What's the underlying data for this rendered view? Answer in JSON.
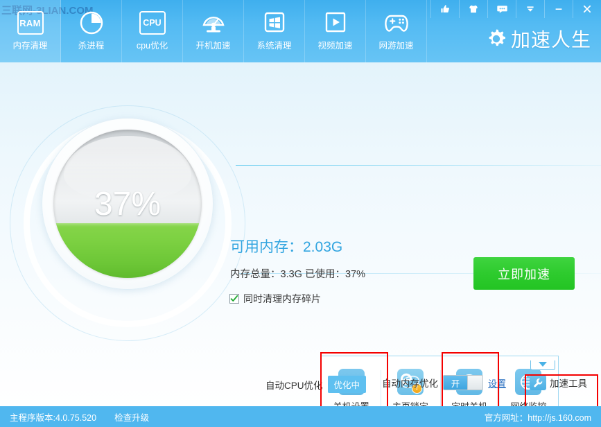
{
  "window": {
    "watermark": "三联网-3LIAN.COM",
    "brand_title": "加速人生",
    "controls": [
      {
        "name": "thumbs-up-icon",
        "label": "赞"
      },
      {
        "name": "skin-icon",
        "label": "换肤"
      },
      {
        "name": "feedback-icon",
        "label": "反馈"
      },
      {
        "name": "menu-icon",
        "label": "菜单"
      },
      {
        "name": "minimize-icon",
        "label": "最小化"
      },
      {
        "name": "close-icon",
        "label": "关闭"
      }
    ]
  },
  "nav": {
    "items": [
      {
        "label": "内存清理",
        "icon": "ram-icon",
        "active": true
      },
      {
        "label": "杀进程",
        "icon": "pie-chart-icon",
        "active": false
      },
      {
        "label": "cpu优化",
        "icon": "cpu-icon",
        "active": false
      },
      {
        "label": "开机加速",
        "icon": "speedometer-monitor-icon",
        "active": false
      },
      {
        "label": "系统清理",
        "icon": "windows-icon",
        "active": false
      },
      {
        "label": "视频加速",
        "icon": "play-video-icon",
        "active": false
      },
      {
        "label": "网游加速",
        "icon": "gamepad-icon",
        "active": false
      }
    ]
  },
  "gauge": {
    "percent_label": "37%",
    "percent_value": 37,
    "fill_color": "#6cc636",
    "body_color": "#e6e9eb"
  },
  "memory": {
    "available_label": "可用内存：2.03G",
    "available_value": "2.03G",
    "totals_label": "内存总量：3.3G   已使用：37%",
    "total_value": "3.3G",
    "used_percent": "37%",
    "checkbox_label": "同时清理内存碎片",
    "checkbox_checked": true,
    "accelerate_button": "立即加速",
    "accent_color": "#32a5e0",
    "button_color": "#2ecb2e"
  },
  "tools": {
    "items": [
      {
        "label": "关机设置",
        "icon": "power-icon",
        "highlighted": true
      },
      {
        "label": "主页锁定",
        "icon": "ie-browser-icon",
        "highlighted": false
      },
      {
        "label": "定时关机",
        "icon": "timer-clock-icon",
        "highlighted": true
      },
      {
        "label": "网络监控",
        "icon": "globe-icon",
        "highlighted": false
      }
    ]
  },
  "options": {
    "cpu_label": "自动CPU优化",
    "cpu_status": "优化中",
    "memory_label": "自动内存优化",
    "memory_switch_on": "开",
    "memory_settings_link": "设置",
    "accel_tools_label": "加速工具",
    "accel_tools_icon": "wrench-icon"
  },
  "statusbar": {
    "version": "主程序版本:4.0.75.520",
    "upgrade_link": "检查升级",
    "official_site": "官方网址：http://js.160.com"
  }
}
